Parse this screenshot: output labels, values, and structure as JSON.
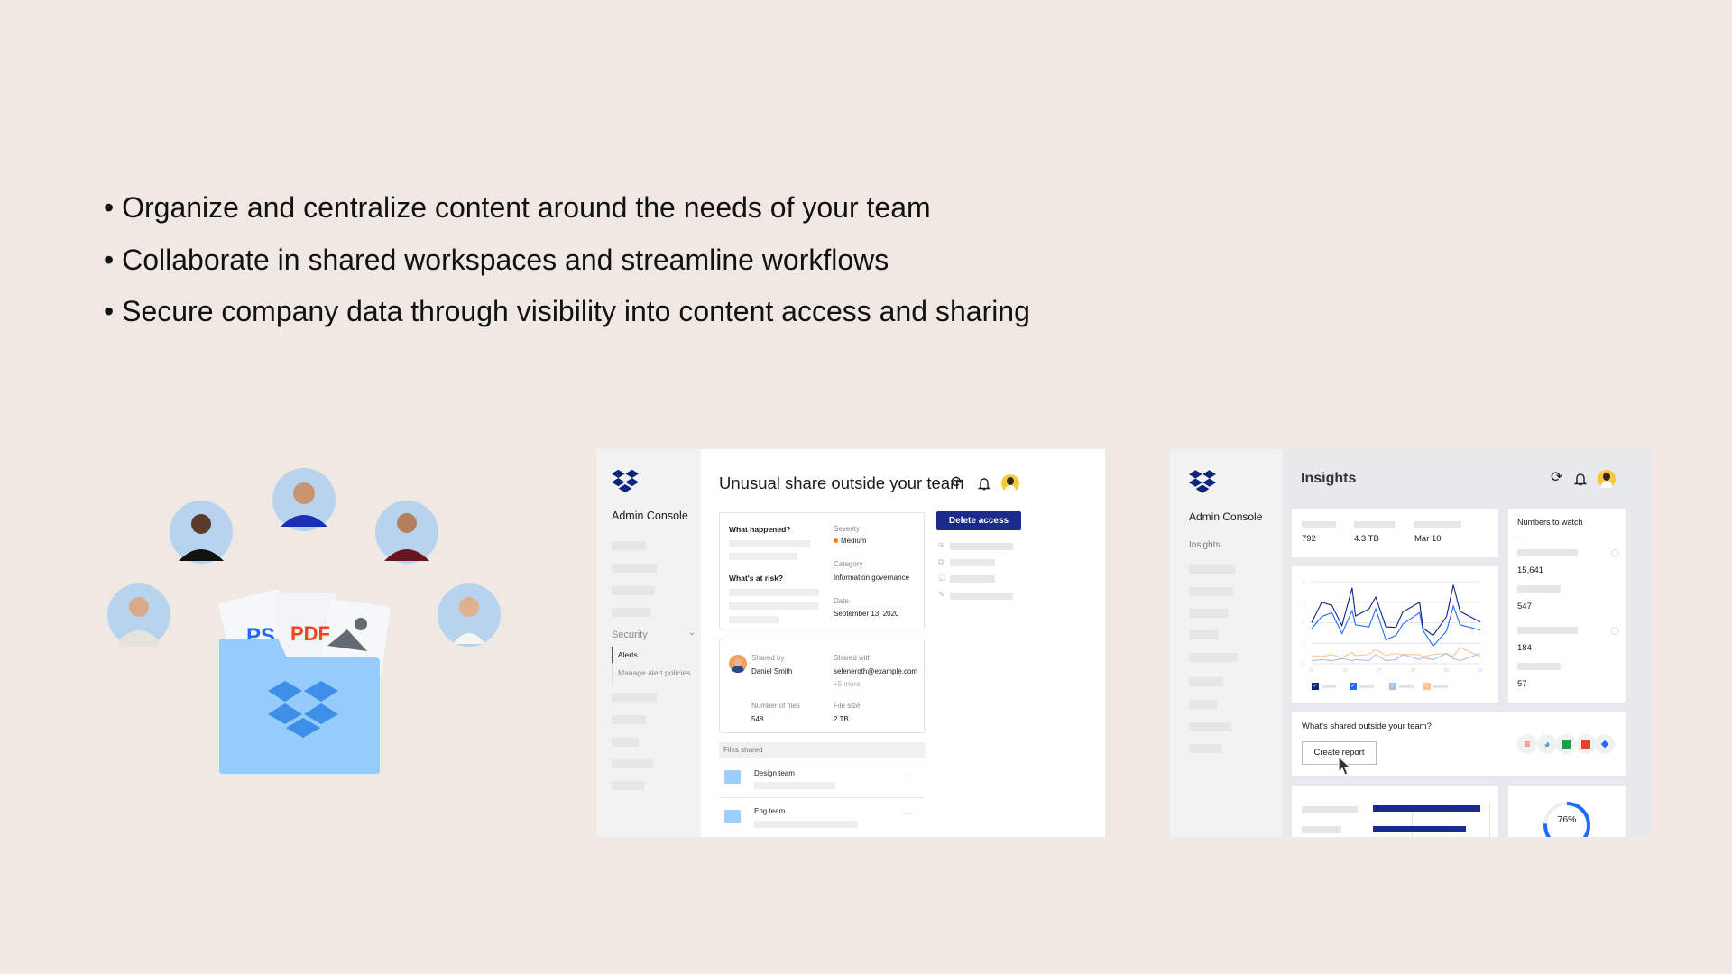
{
  "bullets": [
    "• Organize and centralize content around the needs of your team",
    "• Collaborate in shared workspaces and streamline workflows",
    "• Secure company data through visibility into content access and sharing"
  ],
  "illustration": {
    "file_labels": [
      "PS",
      "PDF"
    ]
  },
  "alert_panel": {
    "sidebar": {
      "title": "Admin Console",
      "section": "Security",
      "items": [
        "Alerts",
        "Manage alert policies"
      ]
    },
    "title": "Unusual share outside your team",
    "delete_button": "Delete access",
    "details": {
      "what_happened": "What happened?",
      "whats_at_risk": "What's at risk?",
      "severity_label": "Severity",
      "severity_value": "Medium",
      "severity_color": "#f77f1e",
      "category_label": "Category",
      "category_value": "Information governance",
      "date_label": "Date",
      "date_value": "September 13, 2020"
    },
    "share": {
      "shared_by_label": "Shared by",
      "shared_by_value": "Daniel Smith",
      "shared_with_label": "Shared with",
      "shared_with_value": "seleneroth@example.com",
      "shared_with_more": "+5 more",
      "files_label": "Number of files",
      "files_value": "548",
      "size_label": "File size",
      "size_value": "2 TB"
    },
    "files_header": "Files shared",
    "files": [
      {
        "name": "Design team",
        "menu": "..."
      },
      {
        "name": "Eng team",
        "menu": "..."
      }
    ]
  },
  "insights_panel": {
    "sidebar": {
      "title": "Admin Console",
      "active": "Insights"
    },
    "title": "Insights",
    "stats": [
      "792",
      "4.3 TB",
      "Mar 10"
    ],
    "numbers_title": "Numbers to watch",
    "numbers": [
      "15,641",
      "547",
      "184",
      "57"
    ],
    "report_question": "What's shared outside your team?",
    "report_button": "Create report",
    "donut_label": "76%",
    "donut_value": 0.76
  },
  "chart_data": {
    "type": "line",
    "x_ticks": [
      "25",
      "26",
      "27",
      "28",
      "29",
      "30"
    ],
    "y_ticks": [
      "0",
      "1",
      "2",
      "3",
      "4"
    ],
    "xlim": [
      25,
      30
    ],
    "ylim": [
      0,
      4
    ],
    "grid": true,
    "x": [
      25,
      25.3,
      25.6,
      25.9,
      26.2,
      26.3,
      26.7,
      26.9,
      27.2,
      27.5,
      27.7,
      28.2,
      28.3,
      28.6,
      29.0,
      29.2,
      29.4,
      30
    ],
    "series": [
      {
        "color": "#0d2481",
        "values": [
          2.0,
          3.0,
          2.85,
          1.86,
          3.7,
          2.33,
          2.67,
          3.25,
          1.8,
          1.77,
          2.52,
          3.0,
          1.74,
          1.38,
          2.3,
          3.84,
          2.55,
          2.04
        ]
      },
      {
        "color": "#1f6bff",
        "values": [
          1.71,
          2.3,
          2.49,
          1.47,
          2.59,
          1.9,
          1.79,
          2.67,
          1.17,
          1.38,
          1.93,
          2.49,
          1.64,
          0.86,
          1.6,
          2.81,
          1.9,
          1.64
        ]
      },
      {
        "color": "#a9bde9",
        "values": [
          0.15,
          0.2,
          0.15,
          0.25,
          0.15,
          0.2,
          0.15,
          0.45,
          0.15,
          0.2,
          0.45,
          0.2,
          0.3,
          0.2,
          0.5,
          0.25,
          0.15,
          0.5
        ]
      },
      {
        "color": "#fcc48e",
        "values": [
          0.4,
          0.35,
          0.45,
          0.3,
          0.55,
          0.4,
          0.45,
          0.7,
          0.4,
          0.5,
          0.45,
          0.45,
          0.35,
          0.45,
          0.5,
          0.35,
          0.8,
          0.35
        ]
      }
    ]
  }
}
